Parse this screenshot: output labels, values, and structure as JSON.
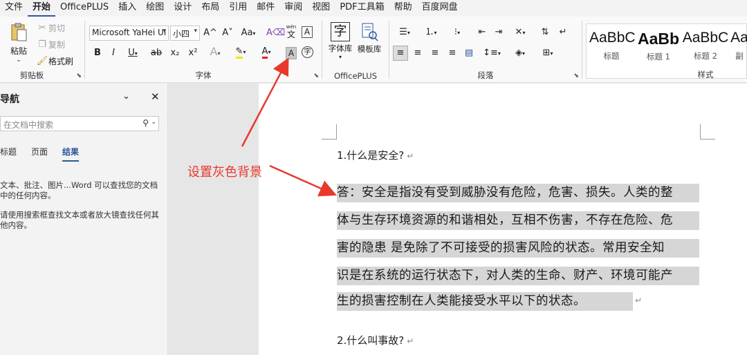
{
  "menubar": {
    "items": [
      "文件",
      "开始",
      "OfficePLUS",
      "插入",
      "绘图",
      "设计",
      "布局",
      "引用",
      "邮件",
      "审阅",
      "视图",
      "PDF工具箱",
      "帮助",
      "百度网盘"
    ],
    "active_index": 1
  },
  "ribbon": {
    "clipboard": {
      "paste": "粘贴",
      "cut": "剪切",
      "copy": "复制",
      "format_painter": "格式刷",
      "label": "剪贴板"
    },
    "font": {
      "font_name": "Microsoft YaHei UI",
      "font_size": "小四",
      "grow": "A^",
      "shrink": "A˅",
      "change_case": "Aa",
      "bold": "B",
      "italic": "I",
      "underline": "U",
      "strike": "ab",
      "subscript": "x₂",
      "superscript": "x²",
      "phonetic_top": "wén",
      "phonetic_bottom": "文",
      "char_border": "A",
      "font_color": "A",
      "char_shading": "A",
      "enclose": "字",
      "label": "字体"
    },
    "officeplus": {
      "char_lib": "字体库",
      "template_lib": "模板库",
      "char_glyph": "字",
      "label": "OfficePLUS"
    },
    "paragraph": {
      "label": "段落"
    },
    "styles": {
      "items": [
        {
          "sample": "AaBbC",
          "name": "标题"
        },
        {
          "sample": "AaBb",
          "name": "标题 1"
        },
        {
          "sample": "AaBbC",
          "name": "标题 2"
        },
        {
          "sample": "Aa",
          "name": "副"
        }
      ],
      "label": "样式"
    }
  },
  "nav": {
    "title": "导航",
    "search_placeholder": "在文档中搜索",
    "tabs": [
      "标题",
      "页面",
      "结果"
    ],
    "active_tab": 2,
    "hint_1_line1": "文本、批注、图片...Word 可以查找您的文档",
    "hint_1_line2": "中的任何内容。",
    "hint_2_line1": "请使用搜索框查找文本或者放大镜查找任何其",
    "hint_2_line2": "他内容。"
  },
  "document": {
    "q1": "1.什么是安全?",
    "para_lines": [
      "答：安全是指没有受到威胁没有危险，危害、损失。人类的整",
      "体与生存环境资源的和谐相处，互相不伤害，不存在危险、危",
      "害的隐患  是免除了不可接受的损害风险的状态。常用安全知",
      "识是在系统的运行状态下，对人类的生命、财产、环境可能产",
      "生的损害控制在人类能接受水平以下的状态。"
    ],
    "q2": "2.什么叫事故?",
    "para_mark": "↵"
  },
  "annotation": {
    "text": "设置灰色背景",
    "color": "#e8382c"
  },
  "colors": {
    "accent": "#2b579a",
    "highlight": "#d6d6d6"
  }
}
